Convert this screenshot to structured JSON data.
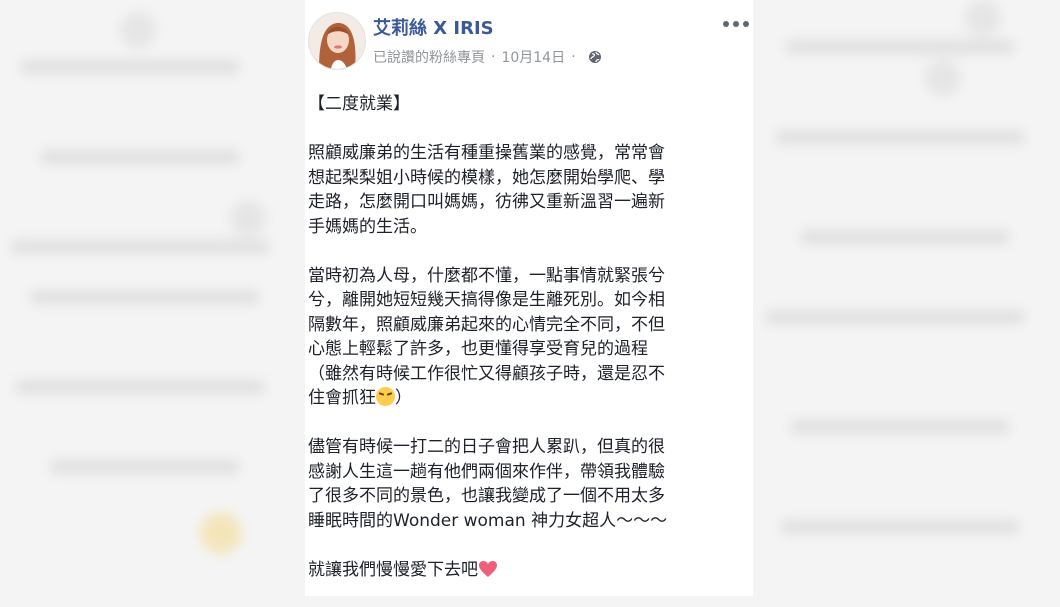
{
  "post": {
    "author": "艾莉絲 X IRIS",
    "page_type": "已說讚的粉絲專頁",
    "separator": "·",
    "date": "10月14日",
    "more_menu_icon": "more-horizontal-icon",
    "privacy_icon": "globe-icon"
  },
  "content": {
    "title": "【二度就業】",
    "paragraph1": [
      "照顧威廉弟的生活有種重操舊業的感覺，常常會",
      "想起梨梨姐小時候的模樣，她怎麼開始學爬、學",
      "走路，怎麼開口叫媽媽，彷彿又重新溫習一遍新",
      "手媽媽的生活。"
    ],
    "paragraph2": [
      "當時初為人母，什麼都不懂，一點事情就緊張兮",
      "兮，離開她短短幾天搞得像是生離死別。如今相",
      "隔數年，照顧威廉弟起來的心情完全不同，不但",
      "心態上輕鬆了許多，也更懂得享受育兒的過程",
      "（雖然有時候工作很忙又得顧孩子時，還是忍不"
    ],
    "paragraph2_last_before": "住會抓狂",
    "paragraph2_last_after": "）",
    "paragraph2_emoji": "tired-face-emoji",
    "paragraph3": [
      "儘管有時候一打二的日子會把人累趴，但真的很",
      "感謝人生這一趟有他們兩個來作伴，帶領我體驗",
      "了很多不同的景色，也讓我變成了一個不用太多",
      "睡眠時間的Wonder woman 神力女超人～～～"
    ],
    "closing": "就讓我們慢慢愛下去吧",
    "closing_emoji": "pink-heart-icon"
  },
  "colors": {
    "author_link": "#3b5998",
    "meta_text": "#90949c",
    "body_text": "#1d2129",
    "heart": "#f0607a"
  }
}
